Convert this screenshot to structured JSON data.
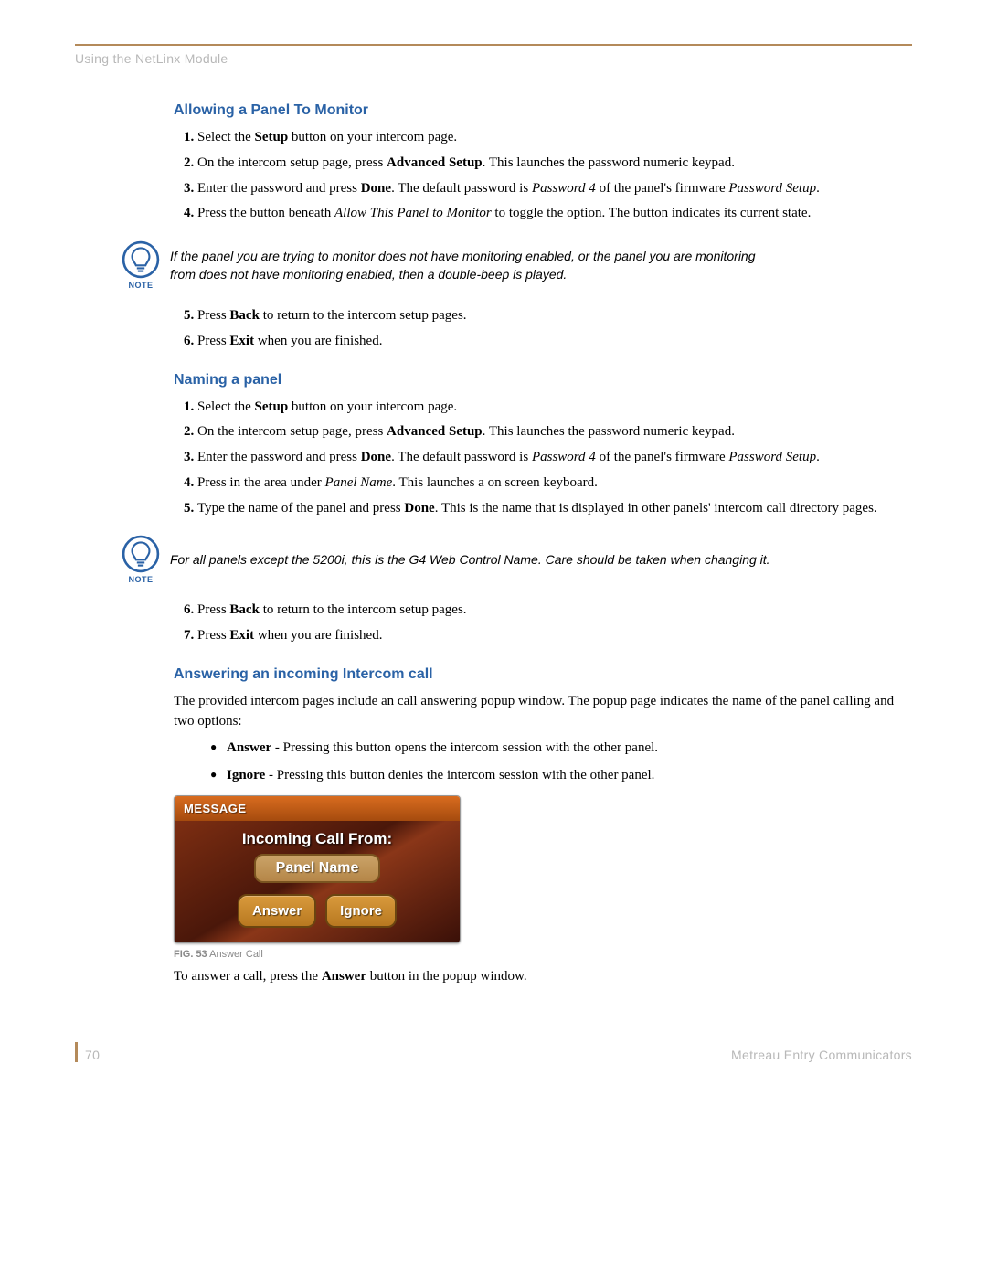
{
  "header": {
    "title": "Using the NetLinx Module"
  },
  "footer": {
    "page": "70",
    "doc": "Metreau Entry Communicators"
  },
  "note_label": "NOTE",
  "section1": {
    "heading": "Allowing a Panel To Monitor",
    "note": "If the panel you are trying to monitor does not have monitoring enabled, or the panel you are monitoring from does not have monitoring enabled, then a double-beep is played."
  },
  "section2": {
    "heading": "Naming a panel",
    "note": "For all panels except the 5200i, this is the G4 Web Control Name. Care should be taken when changing it."
  },
  "section3": {
    "heading": "Answering an incoming Intercom call",
    "intro": "The provided intercom pages include an call answering popup window. The popup page indicates the name of the panel calling and two options:",
    "outro_prefix": "To answer a call, press the ",
    "outro_bold": "Answer",
    "outro_suffix": " button in the popup window."
  },
  "steps": {
    "s1_1_a": "Select the ",
    "s1_1_b": "Setup",
    "s1_1_c": " button on your intercom page.",
    "s1_2_a": "On the intercom setup page, press ",
    "s1_2_b": "Advanced Setup",
    "s1_2_c": ". This launches the password numeric keypad.",
    "s1_3_a": "Enter the password and press ",
    "s1_3_b": "Done",
    "s1_3_c": ". The default password is ",
    "s1_3_d": "Password 4",
    "s1_3_e": " of the panel's firmware ",
    "s1_3_f": "Password Setup",
    "s1_3_g": ".",
    "s1_4_a": "Press the button beneath ",
    "s1_4_b": "Allow This Panel to Monitor",
    "s1_4_c": " to toggle the option. The button indicates its current state.",
    "s1_5_a": "Press ",
    "s1_5_b": "Back",
    "s1_5_c": " to return to the intercom setup pages.",
    "s1_6_a": "Press ",
    "s1_6_b": "Exit",
    "s1_6_c": " when you are finished.",
    "s2_4_a": "Press in the area under ",
    "s2_4_b": "Panel Name",
    "s2_4_c": ". This launches a on screen keyboard.",
    "s2_5_a": "Type the name of the panel and press ",
    "s2_5_b": "Done",
    "s2_5_c": ". This is the name that is displayed in other panels' intercom call directory pages."
  },
  "bullets": {
    "b1_a": "Answer",
    "b1_b": " - Pressing this button opens the intercom session with the other panel.",
    "b2_a": "Ignore",
    "b2_b": " - Pressing this button denies the intercom session with the other panel."
  },
  "popup": {
    "header": "MESSAGE",
    "title": "Incoming Call From:",
    "panel": "Panel Name",
    "answer": "Answer",
    "ignore": "Ignore"
  },
  "fig": {
    "label": "FIG. 53",
    "caption": "  Answer Call"
  }
}
